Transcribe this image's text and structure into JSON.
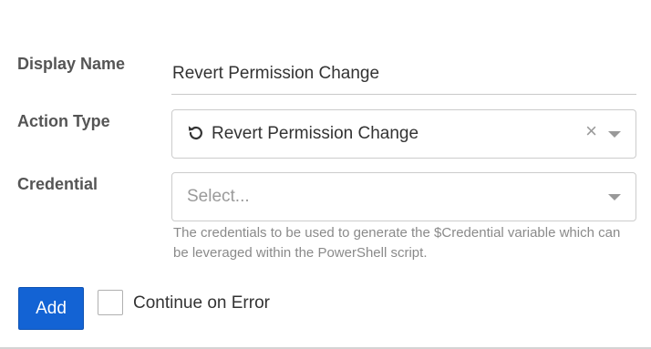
{
  "form": {
    "display_name": {
      "label": "Display Name",
      "value": "Revert Permission Change"
    },
    "action_type": {
      "label": "Action Type",
      "selected": "Revert Permission Change",
      "selected_icon": "undo-icon",
      "clear_symbol": "×",
      "icons": [
        "undo-icon",
        "clear-icon",
        "chevron-down-icon"
      ]
    },
    "credential": {
      "label": "Credential",
      "placeholder": "Select...",
      "help_text": "The credentials to be used to generate the $Credential variable which can be leveraged within the PowerShell script.",
      "icons": [
        "chevron-down-icon"
      ]
    }
  },
  "actions": {
    "add_label": "Add",
    "continue_on_error_label": "Continue on Error",
    "continue_on_error_checked": false
  },
  "colors": {
    "primary": "#1363d4",
    "label": "#555555",
    "text": "#333333",
    "muted": "#8a8a8a",
    "border": "#cccccc"
  }
}
